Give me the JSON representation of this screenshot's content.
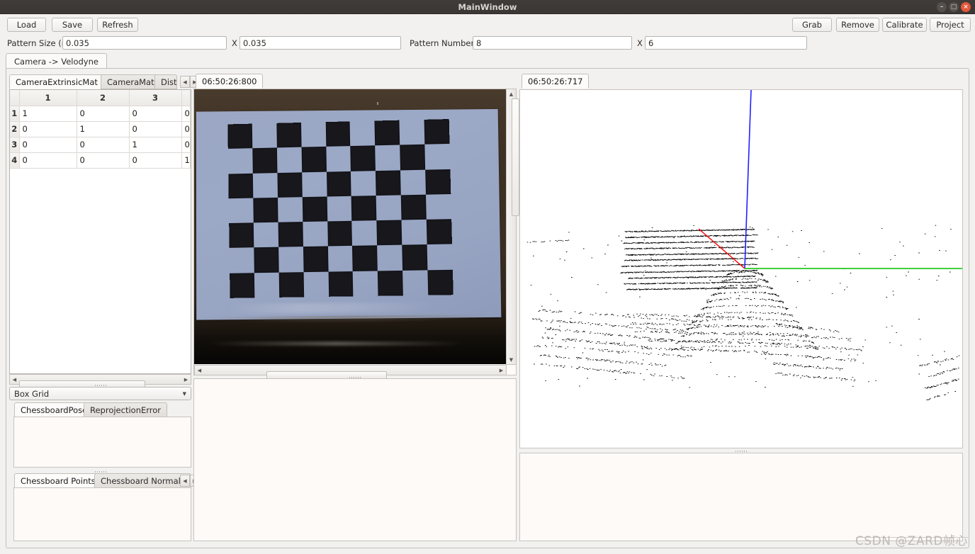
{
  "window": {
    "title": "MainWindow",
    "minimize_label": "—",
    "maximize_label": "□",
    "close_label": "✕"
  },
  "toolbar": {
    "left_buttons": [
      {
        "label": "Load",
        "name": "load-button"
      },
      {
        "label": "Save",
        "name": "save-button"
      },
      {
        "label": "Refresh",
        "name": "refresh-button"
      }
    ],
    "right_buttons": [
      {
        "label": "Grab",
        "name": "grab-button"
      },
      {
        "label": "Remove",
        "name": "remove-button"
      },
      {
        "label": "Calibrate",
        "name": "calibrate-button"
      },
      {
        "label": "Project",
        "name": "project-button"
      }
    ]
  },
  "fields": {
    "pattern_size_label": "Pattern Size (m)",
    "pattern_size_width": "0.035",
    "pattern_size_sep": "X",
    "pattern_size_height": "0.035",
    "pattern_number_label": "Pattern Number",
    "pattern_number_cols": "8",
    "pattern_number_sep": "X",
    "pattern_number_rows": "6"
  },
  "main_tab": {
    "label": "Camera -> Velodyne"
  },
  "matrix_tabs": {
    "items": [
      "CameraExtrinsicMat",
      "CameraMat",
      "DistC"
    ],
    "selected": "CameraExtrinsicMat",
    "scroll_left": "◀",
    "scroll_right": "▶"
  },
  "matrix": {
    "columns": [
      "1",
      "2",
      "3",
      ""
    ],
    "rows": [
      "1",
      "2",
      "3",
      "4"
    ],
    "cells": [
      [
        "1",
        "0",
        "0",
        "0"
      ],
      [
        "0",
        "1",
        "0",
        "0"
      ],
      [
        "0",
        "0",
        "1",
        "0"
      ],
      [
        "0",
        "0",
        "0",
        "1"
      ]
    ]
  },
  "grid_combo": {
    "value": "Box Grid",
    "arrow": "▼"
  },
  "pose_tabs": {
    "items": [
      "ChessboardPose",
      "ReprojectionError"
    ],
    "selected": "ChessboardPose"
  },
  "points_tabs": {
    "items": [
      "Chessboard Points",
      "Chessboard Normals"
    ],
    "selected": "Chessboard Points",
    "scroll_left": "◀",
    "scroll_right": "▶"
  },
  "image_panel": {
    "tab_label": "06:50:26:800",
    "content_description": "chessboard-calibration-photo"
  },
  "cloud_panel": {
    "tab_label": "06:50:26:717",
    "content_description": "velodyne-point-cloud",
    "axis_colors": {
      "x": "#ff0000",
      "y": "#00c000",
      "z": "#2020ff"
    },
    "point_color": "#000000",
    "background": "#ffffff"
  },
  "scrollbars": {
    "up": "▲",
    "down": "▼",
    "left": "◀",
    "right": "▶"
  },
  "watermark": {
    "text": "CSDN @ZARD帧心"
  }
}
